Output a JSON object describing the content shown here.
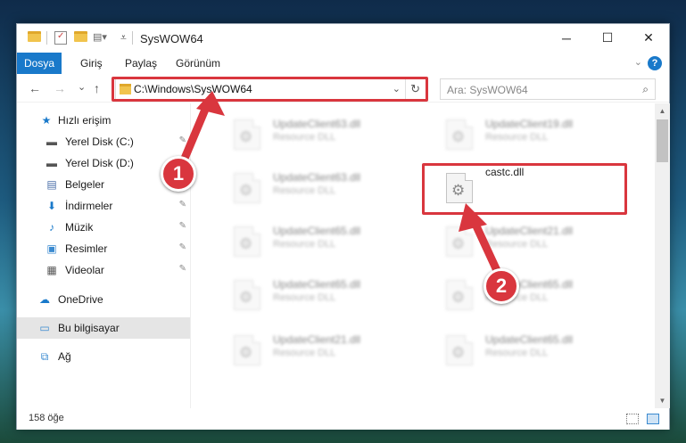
{
  "window": {
    "title": "SysWOW64",
    "controls": {
      "minimize": "─",
      "maximize": "☐",
      "close": "✕"
    }
  },
  "ribbon": {
    "tabs": [
      {
        "label": "Dosya",
        "active": true
      },
      {
        "label": "Giriş"
      },
      {
        "label": "Paylaş"
      },
      {
        "label": "Görünüm"
      }
    ],
    "collapse_icon": "chevron-up-icon",
    "help_icon": "help-icon",
    "help_label": "?"
  },
  "navigation": {
    "back": "←",
    "forward": "→",
    "recent": "⌄",
    "up": "↑",
    "address": "C:\\Windows\\SysWOW64",
    "search_placeholder": "Ara: SysWOW64"
  },
  "sidebar": {
    "items": [
      {
        "label": "Hızlı erişim",
        "icon": "star-icon",
        "glyph": "★",
        "color": "#1979ca"
      },
      {
        "label": "Yerel Disk (C:)",
        "icon": "drive-icon",
        "glyph": "▬",
        "color": "#555555",
        "pinned": true
      },
      {
        "label": "Yerel Disk (D:)",
        "icon": "drive-icon",
        "glyph": "▬",
        "color": "#555555",
        "pinned": false
      },
      {
        "label": "Belgeler",
        "icon": "document-icon",
        "glyph": "▤",
        "color": "#4a6ea8",
        "pinned": true
      },
      {
        "label": "İndirmeler",
        "icon": "download-icon",
        "glyph": "⬇",
        "color": "#1979ca",
        "pinned": true
      },
      {
        "label": "Müzik",
        "icon": "music-icon",
        "glyph": "♪",
        "color": "#1979ca",
        "pinned": true
      },
      {
        "label": "Resimler",
        "icon": "pictures-icon",
        "glyph": "▣",
        "color": "#3a8ad0",
        "pinned": true
      },
      {
        "label": "Videolar",
        "icon": "video-icon",
        "glyph": "▦",
        "color": "#555555",
        "pinned": true
      },
      {
        "label": "OneDrive",
        "icon": "cloud-icon",
        "glyph": "☁",
        "color": "#1979ca"
      },
      {
        "label": "Bu bilgisayar",
        "icon": "computer-icon",
        "glyph": "▭",
        "color": "#3a8ad0",
        "selected": true
      },
      {
        "label": "Ağ",
        "icon": "network-icon",
        "glyph": "⧉",
        "color": "#3a8ad0"
      }
    ],
    "pin_glyph": "✎"
  },
  "files": [
    {
      "name": "UpdateClient63.dll",
      "type": "Resource DLL",
      "blurred": true
    },
    {
      "name": "UpdateClient19.dll",
      "type": "Resource DLL",
      "blurred": true
    },
    {
      "name": "UpdateClient63.dll",
      "type": "Resource DLL",
      "blurred": true
    },
    {
      "name": "castc.dll",
      "type": "",
      "blurred": false,
      "highlighted": true
    },
    {
      "name": "UpdateClient65.dll",
      "type": "Resource DLL",
      "blurred": true
    },
    {
      "name": "UpdateClient21.dll",
      "type": "Resource DLL",
      "blurred": true
    },
    {
      "name": "UpdateClient65.dll",
      "type": "Resource DLL",
      "blurred": true
    },
    {
      "name": "UpdateClient65.dll",
      "type": "Resource DLL",
      "blurred": true
    },
    {
      "name": "UpdateClient21.dll",
      "type": "Resource DLL",
      "blurred": true
    },
    {
      "name": "UpdateClient65.dll",
      "type": "Resource DLL",
      "blurred": true
    }
  ],
  "file_icon": "gear-file-icon",
  "status": {
    "count": "158 öğe"
  },
  "annotations": {
    "step1": "1",
    "step2": "2",
    "color": "#d9363e"
  }
}
